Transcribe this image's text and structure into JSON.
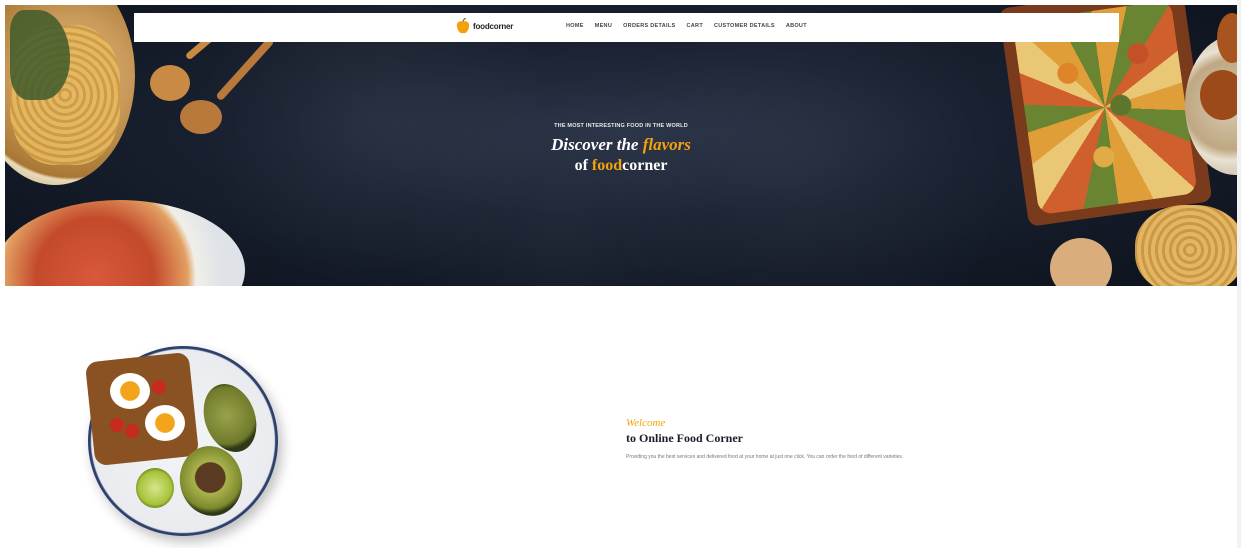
{
  "brand": {
    "name": "foodcorner",
    "logo_icon": "apple-logo-icon",
    "accent_color": "#f4a20c"
  },
  "nav": {
    "items": [
      {
        "label": "HOME"
      },
      {
        "label": "MENU"
      },
      {
        "label": "ORDERS DETAILS"
      },
      {
        "label": "CART"
      },
      {
        "label": "CUSTOMER DETAILS"
      },
      {
        "label": "ABOUT"
      }
    ]
  },
  "hero": {
    "kicker": "THE MOST INTERESTING FOOD IN THE WORLD",
    "title_prefix": "Discover the ",
    "title_accent": "flavors",
    "sub_prefix": "of ",
    "sub_accent": "food",
    "sub_suffix": "corner"
  },
  "welcome": {
    "kicker": "Welcome",
    "title": "to Online Food Corner",
    "description": "Providing you the best services and delivered food at your home at just one click. You can order the food of different varieties."
  }
}
